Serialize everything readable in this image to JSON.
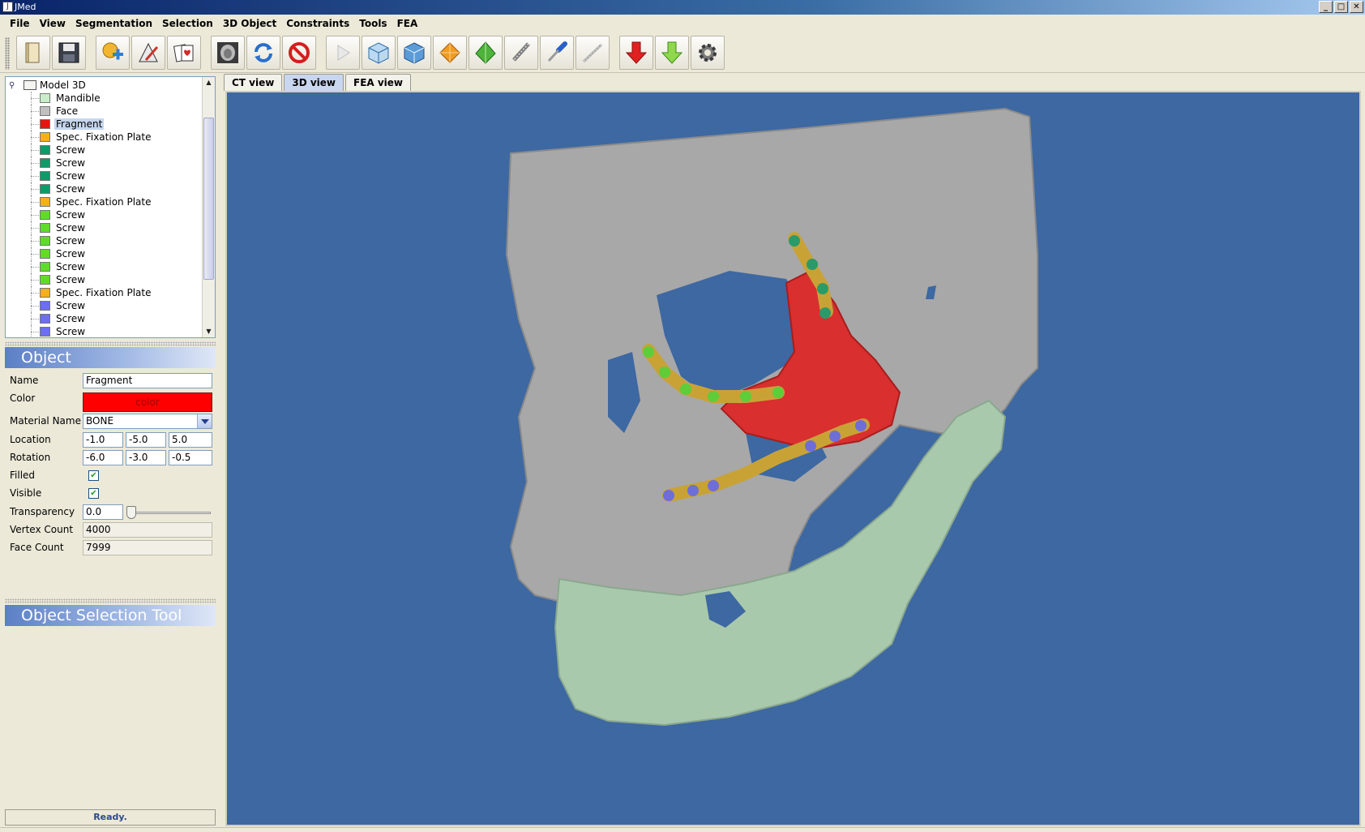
{
  "window": {
    "title": "JMed",
    "controls": [
      "_",
      "□",
      "✕"
    ]
  },
  "menu": [
    "File",
    "View",
    "Segmentation",
    "Selection",
    "3D Object",
    "Constraints",
    "Tools",
    "FEA"
  ],
  "toolbar_icons": [
    "open-icon",
    "save-icon",
    "add-object-icon",
    "edit-object-icon",
    "cards-icon",
    "ct-scan-icon",
    "refresh-icon",
    "stop-icon",
    "play-icon",
    "cube-icon",
    "cube-outline-icon",
    "diamond-icon",
    "pyramid-icon",
    "screw-icon",
    "screwdriver-icon",
    "ruler-icon",
    "down-arrow-red-icon",
    "down-arrow-green-icon",
    "gear-icon"
  ],
  "tree": {
    "root": "Model 3D",
    "items": [
      {
        "label": "Mandible",
        "color": "#c9ecc9"
      },
      {
        "label": "Face",
        "color": "#c0c0c0"
      },
      {
        "label": "Fragment",
        "color": "#e81414",
        "selected": true
      },
      {
        "label": "Spec. Fixation Plate",
        "color": "#f3b01a"
      },
      {
        "label": "Screw",
        "color": "#109a6a"
      },
      {
        "label": "Screw",
        "color": "#109a6a"
      },
      {
        "label": "Screw",
        "color": "#109a6a"
      },
      {
        "label": "Screw",
        "color": "#109a6a"
      },
      {
        "label": "Spec. Fixation Plate",
        "color": "#f3b01a"
      },
      {
        "label": "Screw",
        "color": "#5fdc2a"
      },
      {
        "label": "Screw",
        "color": "#5fdc2a"
      },
      {
        "label": "Screw",
        "color": "#5fdc2a"
      },
      {
        "label": "Screw",
        "color": "#5fdc2a"
      },
      {
        "label": "Screw",
        "color": "#5fdc2a"
      },
      {
        "label": "Screw",
        "color": "#5fdc2a"
      },
      {
        "label": "Spec. Fixation Plate",
        "color": "#f3b01a"
      },
      {
        "label": "Screw",
        "color": "#6d6ef0"
      },
      {
        "label": "Screw",
        "color": "#6d6ef0"
      },
      {
        "label": "Screw",
        "color": "#6d6ef0"
      }
    ]
  },
  "object_panel": {
    "header": "Object",
    "labels": {
      "name": "Name",
      "color": "Color",
      "material": "Material Name",
      "location": "Location",
      "rotation": "Rotation",
      "filled": "Filled",
      "visible": "Visible",
      "transparency": "Transparency",
      "vertex_count": "Vertex Count",
      "face_count": "Face Count"
    },
    "values": {
      "name": "Fragment",
      "color_button": "color",
      "material": "BONE",
      "location": [
        "-1.0",
        "-5.0",
        "5.0"
      ],
      "rotation": [
        "-6.0",
        "-3.0",
        "-0.5"
      ],
      "filled": "✔",
      "visible": "✔",
      "transparency": "0.0",
      "vertex_count": "4000",
      "face_count": "7999"
    },
    "color_value": "#ff0000"
  },
  "selection_tool": {
    "header": "Object Selection Tool"
  },
  "status": "Ready.",
  "tabs": [
    {
      "label": "CT view",
      "active": false
    },
    {
      "label": "3D view",
      "active": true
    },
    {
      "label": "FEA view",
      "active": false
    }
  ],
  "viewport": {
    "background": "#3d68a2",
    "colors": {
      "face": "#a8a8a8",
      "mandible": "#a9c9ad",
      "fragment": "#d92f2f",
      "plate": "#c9a236",
      "screw_group1": "#2a9a6a",
      "screw_group2": "#5fcc3a",
      "screw_group3": "#6e6ed8"
    }
  }
}
